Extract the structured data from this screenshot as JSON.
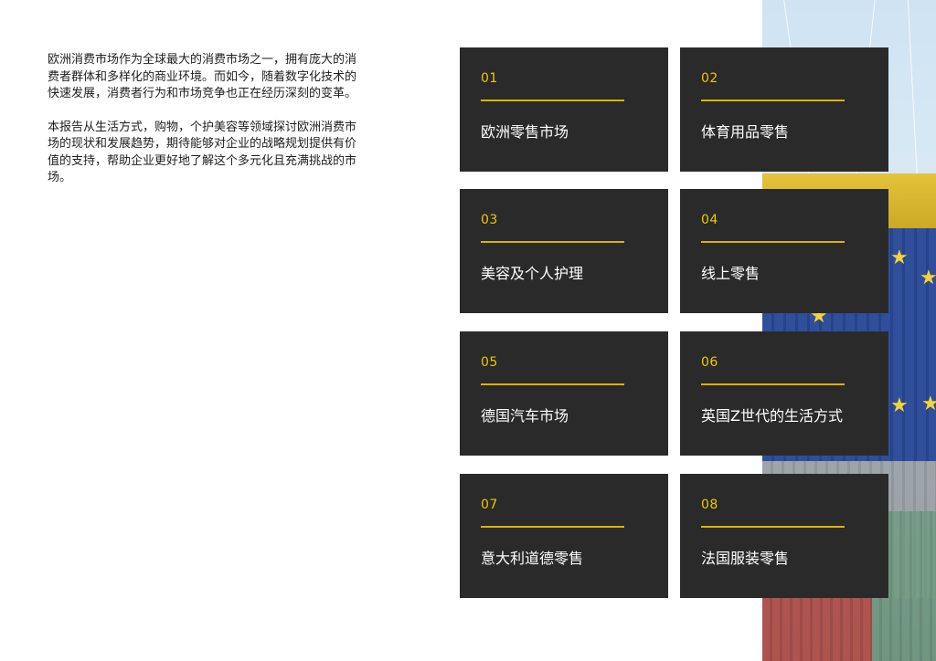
{
  "intro": {
    "paragraph1": "欧洲消费市场作为全球最大的消费市场之一，拥有庞大的消费者群体和多样化的商业环境。而如今，随着数字化技术的快速发展，消费者行为和市场竞争也正在经历深刻的变革。",
    "paragraph2": "本报告从生活方式，购物，个护美容等领域探讨欧洲消费市场的现状和发展趋势，期待能够对企业的战略规划提供有价值的支持，帮助企业更好地了解这个多元化且充满挑战的市场。"
  },
  "colors": {
    "card_bg": "#2a2a2a",
    "accent": "#f2c500",
    "title": "#ffffff"
  },
  "cards": [
    {
      "num": "01",
      "title": "欧洲零售市场"
    },
    {
      "num": "02",
      "title": "体育用品零售"
    },
    {
      "num": "03",
      "title": "美容及个人护理"
    },
    {
      "num": "04",
      "title": "线上零售"
    },
    {
      "num": "05",
      "title": "德国汽车市场"
    },
    {
      "num": "06",
      "title": "英国Z世代的生活方式"
    },
    {
      "num": "07",
      "title": "意大利道德零售"
    },
    {
      "num": "08",
      "title": "法国服装零售"
    }
  ]
}
